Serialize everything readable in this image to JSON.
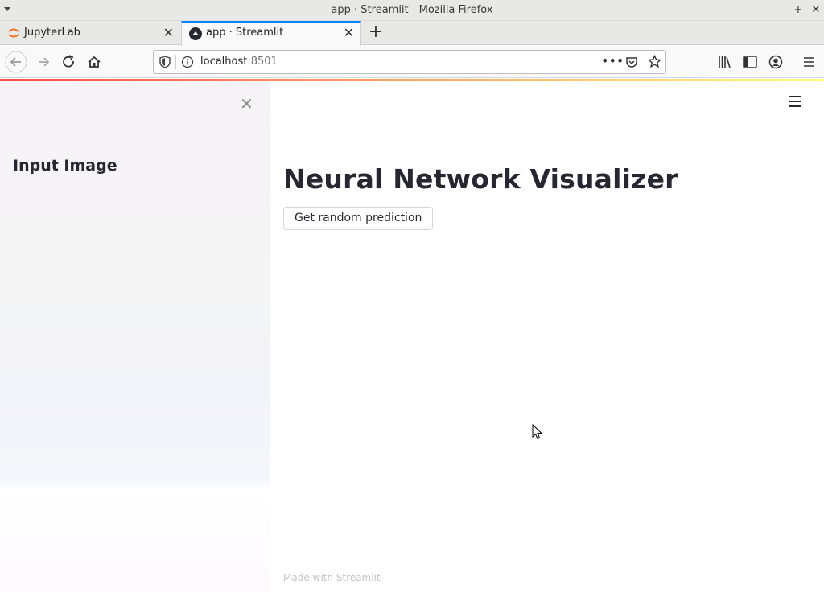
{
  "window": {
    "title": "app · Streamlit - Mozilla Firefox"
  },
  "tabs": [
    {
      "label": "JupyterLab",
      "active": false,
      "favicon": "jupyter-icon"
    },
    {
      "label": "app · Streamlit",
      "active": true,
      "favicon": "streamlit-icon"
    }
  ],
  "urlbar": {
    "host": "localhost",
    "port": ":8501"
  },
  "sidebar": {
    "heading": "Input Image"
  },
  "main": {
    "title": "Neural Network Visualizer",
    "button_label": "Get random prediction",
    "footer": "Made with Streamlit"
  },
  "colors": {
    "accent_tab": "#0a84ff",
    "deco_start": "#ff4b4b",
    "deco_end": "#fffd80",
    "text": "#262730"
  }
}
